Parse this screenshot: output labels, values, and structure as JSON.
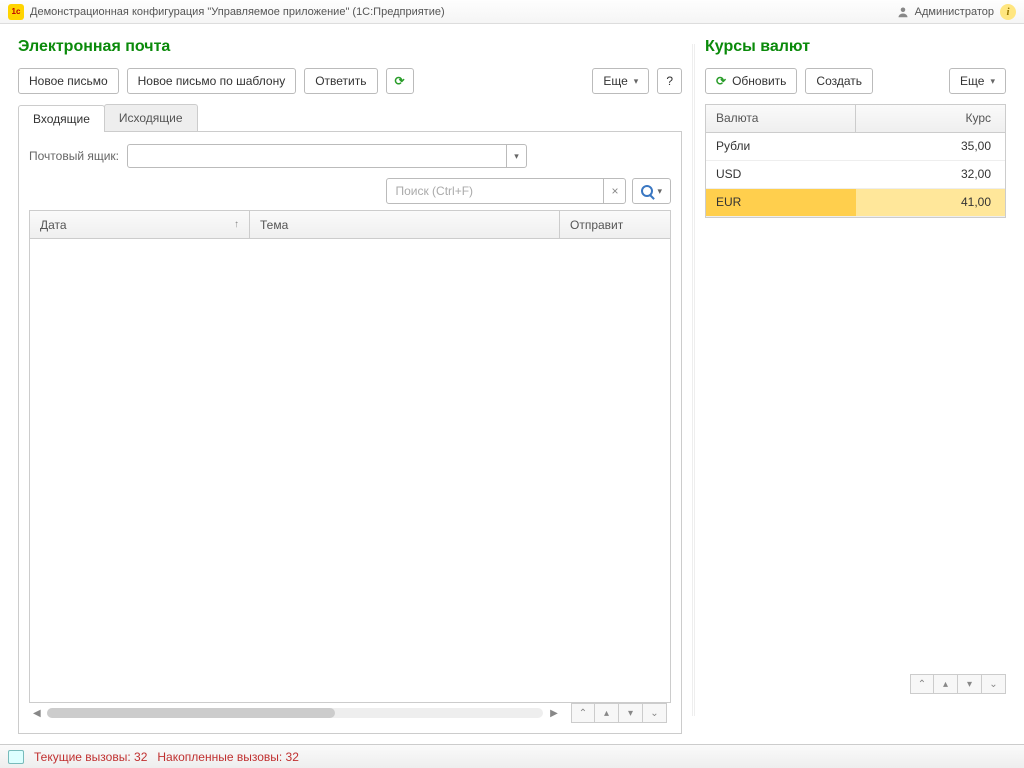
{
  "titlebar": {
    "app_title": "Демонстрационная конфигурация \"Управляемое приложение\"  (1С:Предприятие)",
    "user": "Администратор"
  },
  "email": {
    "title": "Электронная почта",
    "new_button": "Новое письмо",
    "new_template_button": "Новое письмо по шаблону",
    "reply_button": "Ответить",
    "more_button": "Еще",
    "help_button": "?",
    "tab_inbox": "Входящие",
    "tab_outbox": "Исходящие",
    "mailbox_label": "Почтовый ящик:",
    "search_placeholder": "Поиск (Ctrl+F)",
    "columns": {
      "date": "Дата",
      "subject": "Тема",
      "from": "Отправит"
    }
  },
  "rates": {
    "title": "Курсы валют",
    "refresh_button": "Обновить",
    "create_button": "Создать",
    "more_button": "Еще",
    "columns": {
      "currency": "Валюта",
      "rate": "Курс"
    },
    "rows": [
      {
        "name": "Рубли",
        "rate": "35,00"
      },
      {
        "name": "USD",
        "rate": "32,00"
      },
      {
        "name": "EUR",
        "rate": "41,00"
      }
    ]
  },
  "status": {
    "current_label": "Текущие вызовы: ",
    "current_value": "32",
    "accumulated_label": "Накопленные вызовы: ",
    "accumulated_value": "32"
  }
}
